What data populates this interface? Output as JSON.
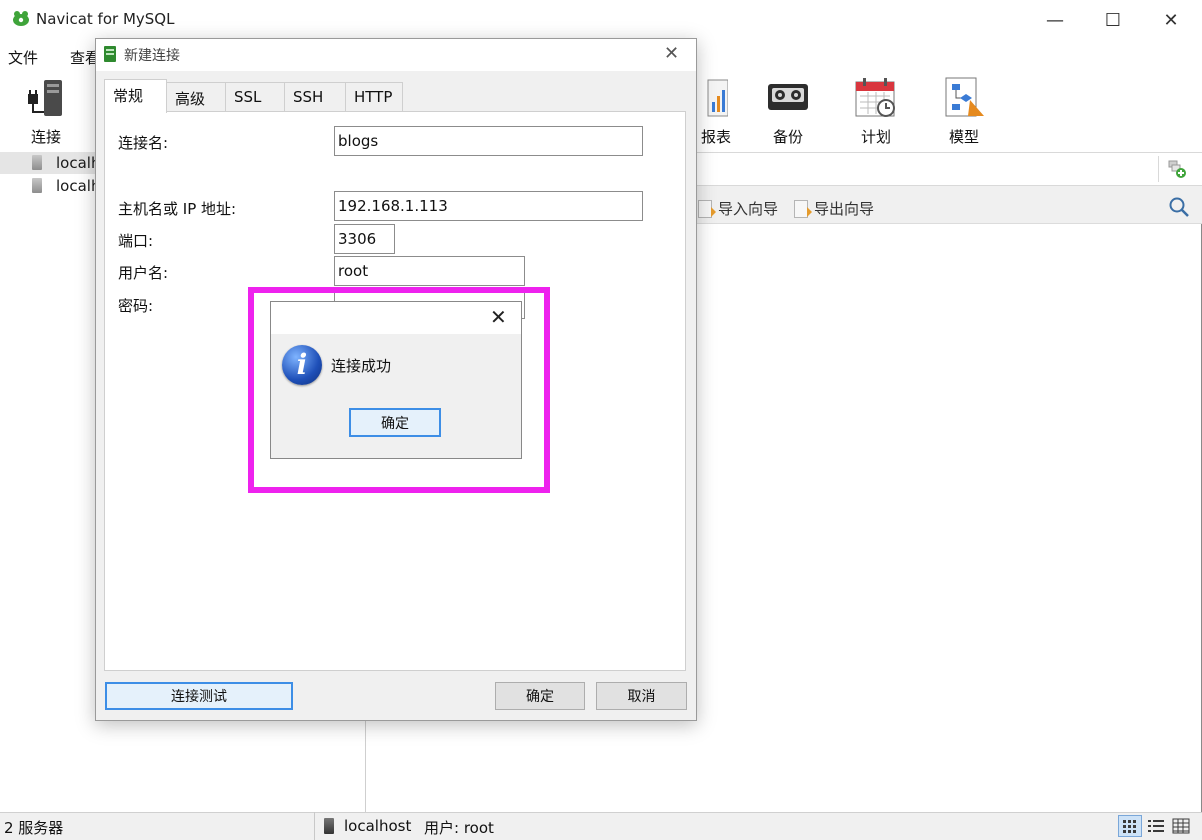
{
  "app": {
    "title": "Navicat for MySQL",
    "menu": [
      "文件",
      "查看"
    ],
    "window_controls": [
      "—",
      "☐",
      "✕"
    ]
  },
  "toolbar": {
    "items": [
      {
        "label": "连接",
        "icon": "connection-plug-icon"
      },
      {
        "label": "报表",
        "icon": "report-icon"
      },
      {
        "label": "备份",
        "icon": "backup-tape-icon"
      },
      {
        "label": "计划",
        "icon": "calendar-schedule-icon"
      },
      {
        "label": "模型",
        "icon": "model-diagram-icon"
      }
    ]
  },
  "nav": {
    "connections": [
      "localh",
      "localh"
    ]
  },
  "objects": {
    "actions": [
      "导入向导",
      "导出向导"
    ]
  },
  "status": {
    "server_count": "2 服务器",
    "connection": "localhost",
    "user": "用户: root"
  },
  "dialog": {
    "title": "新建连接",
    "tabs": [
      "常规",
      "高级",
      "SSL",
      "SSH",
      "HTTP"
    ],
    "active_tab": "常规",
    "fields": {
      "conn_name_label": "连接名:",
      "conn_name_value": "blogs",
      "host_label": "主机名或 IP 地址:",
      "host_value": "192.168.1.113",
      "port_label": "端口:",
      "port_value": "3306",
      "user_label": "用户名:",
      "user_value": "root",
      "password_label": "密码:"
    },
    "buttons": {
      "test": "连接测试",
      "ok": "确定",
      "cancel": "取消"
    }
  },
  "message": {
    "text": "连接成功",
    "ok": "确定",
    "icon": "info-icon",
    "highlight_color": "#ee22ee"
  },
  "colors": {
    "accent_border": "#3d8ee6",
    "highlight": "#ee22ee"
  }
}
